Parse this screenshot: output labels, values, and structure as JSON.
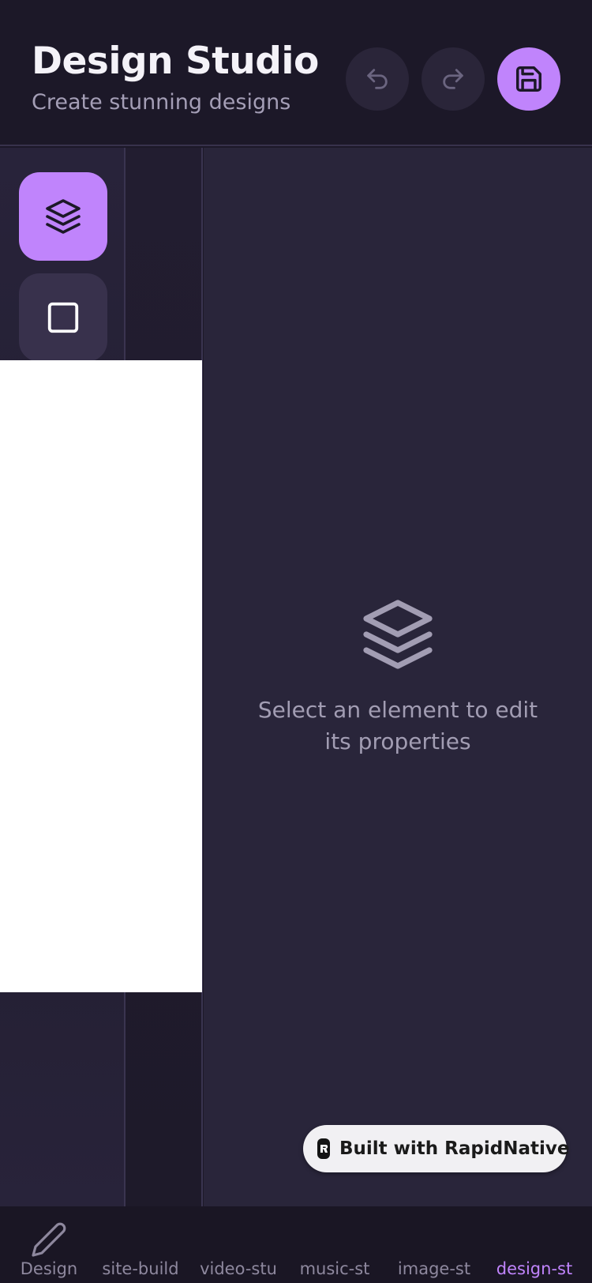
{
  "header": {
    "title": "Design Studio",
    "subtitle": "Create stunning designs",
    "undo_icon": "undo-icon",
    "redo_icon": "redo-icon",
    "save_icon": "save-icon"
  },
  "tools": [
    {
      "name": "layers",
      "icon": "layers-icon",
      "active": true
    },
    {
      "name": "rectangle",
      "icon": "square-icon",
      "active": false
    }
  ],
  "properties": {
    "empty_message": "Select an element to edit its properties",
    "empty_icon": "layers-icon"
  },
  "badge": {
    "text": "Built with RapidNative"
  },
  "tabs": [
    {
      "label": "Design",
      "icon": "pencil-icon",
      "active": false
    },
    {
      "label": "site-build",
      "active": false
    },
    {
      "label": "video-stu",
      "active": false
    },
    {
      "label": "music-st",
      "active": false
    },
    {
      "label": "image-st",
      "active": false
    },
    {
      "label": "design-st",
      "active": true
    }
  ],
  "colors": {
    "accent": "#c084fc",
    "background": "#1c1828",
    "panel": "#29253a"
  }
}
